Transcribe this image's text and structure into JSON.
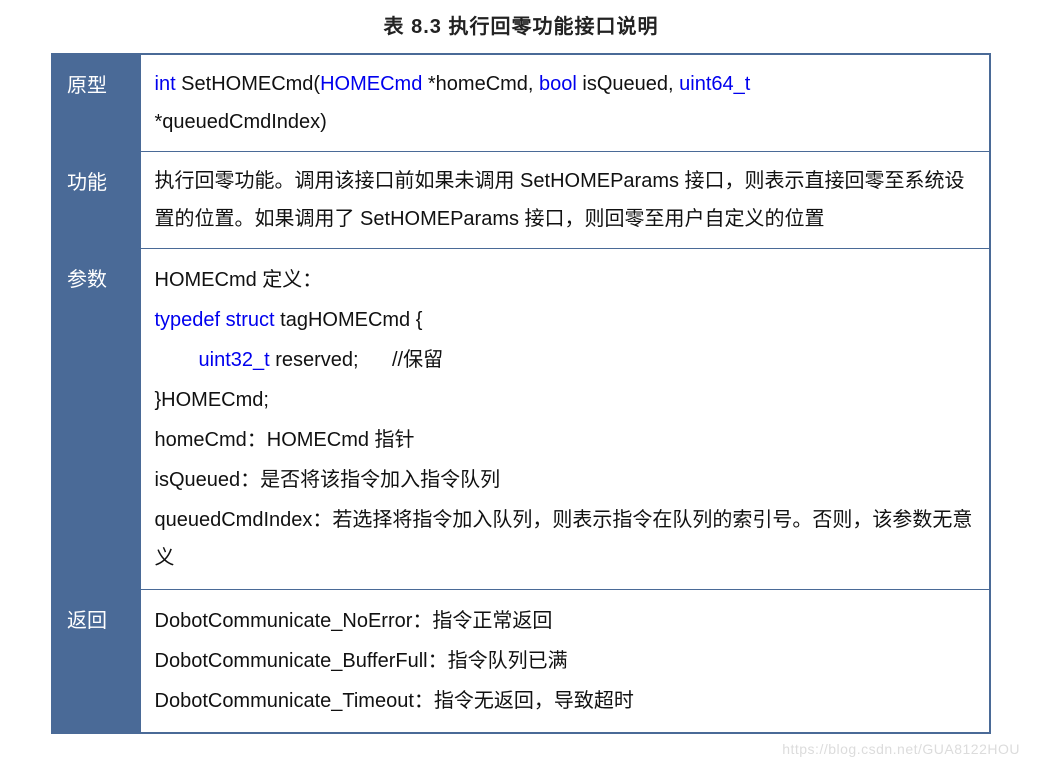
{
  "title": "表 8.3   执行回零功能接口说明",
  "rows": {
    "proto": {
      "label": "原型",
      "tok": {
        "t1": "int",
        "t2": " SetHOMECmd(",
        "t3": "HOMECmd",
        "t4": " *homeCmd, ",
        "t5": "bool",
        "t6": " isQueued, ",
        "t7": "uint64_t",
        "t8": "*queuedCmdIndex)"
      }
    },
    "func": {
      "label": "功能",
      "text": "执行回零功能。调用该接口前如果未调用 SetHOMEParams 接口，则表示直接回零至系统设置的位置。如果调用了 SetHOMEParams 接口，则回零至用户自定义的位置"
    },
    "params": {
      "label": "参数",
      "l1": "HOMECmd 定义：",
      "l2a": "typedef",
      "l2b": " ",
      "l2c": "struct",
      "l2d": " tagHOMECmd {",
      "l3a": "uint32_t",
      "l3b": " reserved;",
      "l3c": "//保留",
      "l4": "}HOMECmd;",
      "l5": "homeCmd：HOMECmd 指针",
      "l6": "isQueued：是否将该指令加入指令队列",
      "l7": "queuedCmdIndex：若选择将指令加入队列，则表示指令在队列的索引号。否则，该参数无意义"
    },
    "ret": {
      "label": "返回",
      "l1": "DobotCommunicate_NoError：指令正常返回",
      "l2": "DobotCommunicate_BufferFull：指令队列已满",
      "l3": "DobotCommunicate_Timeout：指令无返回，导致超时"
    }
  },
  "watermark": "https://blog.csdn.net/GUA8122HOU"
}
